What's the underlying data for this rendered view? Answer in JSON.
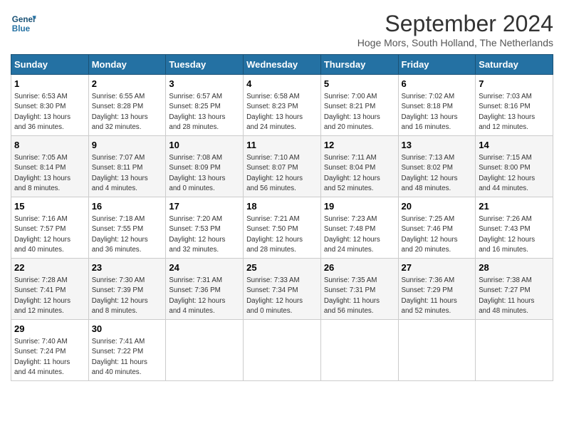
{
  "logo": {
    "line1": "General",
    "line2": "Blue"
  },
  "title": "September 2024",
  "subtitle": "Hoge Mors, South Holland, The Netherlands",
  "headers": [
    "Sunday",
    "Monday",
    "Tuesday",
    "Wednesday",
    "Thursday",
    "Friday",
    "Saturday"
  ],
  "weeks": [
    [
      {
        "day": "1",
        "info": "Sunrise: 6:53 AM\nSunset: 8:30 PM\nDaylight: 13 hours\nand 36 minutes."
      },
      {
        "day": "2",
        "info": "Sunrise: 6:55 AM\nSunset: 8:28 PM\nDaylight: 13 hours\nand 32 minutes."
      },
      {
        "day": "3",
        "info": "Sunrise: 6:57 AM\nSunset: 8:25 PM\nDaylight: 13 hours\nand 28 minutes."
      },
      {
        "day": "4",
        "info": "Sunrise: 6:58 AM\nSunset: 8:23 PM\nDaylight: 13 hours\nand 24 minutes."
      },
      {
        "day": "5",
        "info": "Sunrise: 7:00 AM\nSunset: 8:21 PM\nDaylight: 13 hours\nand 20 minutes."
      },
      {
        "day": "6",
        "info": "Sunrise: 7:02 AM\nSunset: 8:18 PM\nDaylight: 13 hours\nand 16 minutes."
      },
      {
        "day": "7",
        "info": "Sunrise: 7:03 AM\nSunset: 8:16 PM\nDaylight: 13 hours\nand 12 minutes."
      }
    ],
    [
      {
        "day": "8",
        "info": "Sunrise: 7:05 AM\nSunset: 8:14 PM\nDaylight: 13 hours\nand 8 minutes."
      },
      {
        "day": "9",
        "info": "Sunrise: 7:07 AM\nSunset: 8:11 PM\nDaylight: 13 hours\nand 4 minutes."
      },
      {
        "day": "10",
        "info": "Sunrise: 7:08 AM\nSunset: 8:09 PM\nDaylight: 13 hours\nand 0 minutes."
      },
      {
        "day": "11",
        "info": "Sunrise: 7:10 AM\nSunset: 8:07 PM\nDaylight: 12 hours\nand 56 minutes."
      },
      {
        "day": "12",
        "info": "Sunrise: 7:11 AM\nSunset: 8:04 PM\nDaylight: 12 hours\nand 52 minutes."
      },
      {
        "day": "13",
        "info": "Sunrise: 7:13 AM\nSunset: 8:02 PM\nDaylight: 12 hours\nand 48 minutes."
      },
      {
        "day": "14",
        "info": "Sunrise: 7:15 AM\nSunset: 8:00 PM\nDaylight: 12 hours\nand 44 minutes."
      }
    ],
    [
      {
        "day": "15",
        "info": "Sunrise: 7:16 AM\nSunset: 7:57 PM\nDaylight: 12 hours\nand 40 minutes."
      },
      {
        "day": "16",
        "info": "Sunrise: 7:18 AM\nSunset: 7:55 PM\nDaylight: 12 hours\nand 36 minutes."
      },
      {
        "day": "17",
        "info": "Sunrise: 7:20 AM\nSunset: 7:53 PM\nDaylight: 12 hours\nand 32 minutes."
      },
      {
        "day": "18",
        "info": "Sunrise: 7:21 AM\nSunset: 7:50 PM\nDaylight: 12 hours\nand 28 minutes."
      },
      {
        "day": "19",
        "info": "Sunrise: 7:23 AM\nSunset: 7:48 PM\nDaylight: 12 hours\nand 24 minutes."
      },
      {
        "day": "20",
        "info": "Sunrise: 7:25 AM\nSunset: 7:46 PM\nDaylight: 12 hours\nand 20 minutes."
      },
      {
        "day": "21",
        "info": "Sunrise: 7:26 AM\nSunset: 7:43 PM\nDaylight: 12 hours\nand 16 minutes."
      }
    ],
    [
      {
        "day": "22",
        "info": "Sunrise: 7:28 AM\nSunset: 7:41 PM\nDaylight: 12 hours\nand 12 minutes."
      },
      {
        "day": "23",
        "info": "Sunrise: 7:30 AM\nSunset: 7:39 PM\nDaylight: 12 hours\nand 8 minutes."
      },
      {
        "day": "24",
        "info": "Sunrise: 7:31 AM\nSunset: 7:36 PM\nDaylight: 12 hours\nand 4 minutes."
      },
      {
        "day": "25",
        "info": "Sunrise: 7:33 AM\nSunset: 7:34 PM\nDaylight: 12 hours\nand 0 minutes."
      },
      {
        "day": "26",
        "info": "Sunrise: 7:35 AM\nSunset: 7:31 PM\nDaylight: 11 hours\nand 56 minutes."
      },
      {
        "day": "27",
        "info": "Sunrise: 7:36 AM\nSunset: 7:29 PM\nDaylight: 11 hours\nand 52 minutes."
      },
      {
        "day": "28",
        "info": "Sunrise: 7:38 AM\nSunset: 7:27 PM\nDaylight: 11 hours\nand 48 minutes."
      }
    ],
    [
      {
        "day": "29",
        "info": "Sunrise: 7:40 AM\nSunset: 7:24 PM\nDaylight: 11 hours\nand 44 minutes."
      },
      {
        "day": "30",
        "info": "Sunrise: 7:41 AM\nSunset: 7:22 PM\nDaylight: 11 hours\nand 40 minutes."
      },
      {
        "day": "",
        "info": ""
      },
      {
        "day": "",
        "info": ""
      },
      {
        "day": "",
        "info": ""
      },
      {
        "day": "",
        "info": ""
      },
      {
        "day": "",
        "info": ""
      }
    ]
  ]
}
